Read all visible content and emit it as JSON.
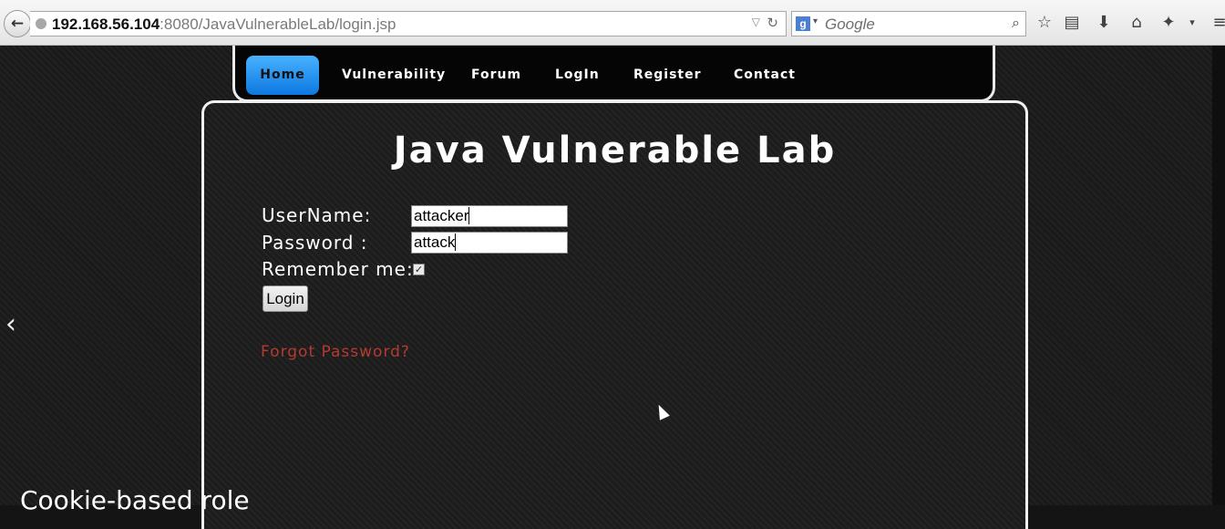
{
  "browser": {
    "url_host": "192.168.56.104",
    "url_rest": ":8080/JavaVulnerableLab/login.jsp",
    "search_placeholder": "Google",
    "back_glyph": "←",
    "icons": [
      "star-icon",
      "reading-list-icon",
      "download-icon",
      "home-icon",
      "extension-icon",
      "menu-icon"
    ]
  },
  "nav": {
    "items": [
      "Home",
      "Vulnerability",
      "Forum",
      "LogIn",
      "Register",
      "Contact"
    ],
    "active": "Home"
  },
  "main": {
    "title": "Java Vulnerable Lab",
    "username_label": "UserName:",
    "username_value": "attacker",
    "password_label": "Password :",
    "password_value": "attack",
    "remember_label": "Remember me:",
    "remember_checked": true,
    "login_button": "Login",
    "forgot_link": "Forgot Password?"
  },
  "caption": "Cookie-based role",
  "colors": {
    "nav_active": "#1e8ff0",
    "forgot_link": "#b53a2f",
    "page_bg": "#1a1a1a"
  }
}
